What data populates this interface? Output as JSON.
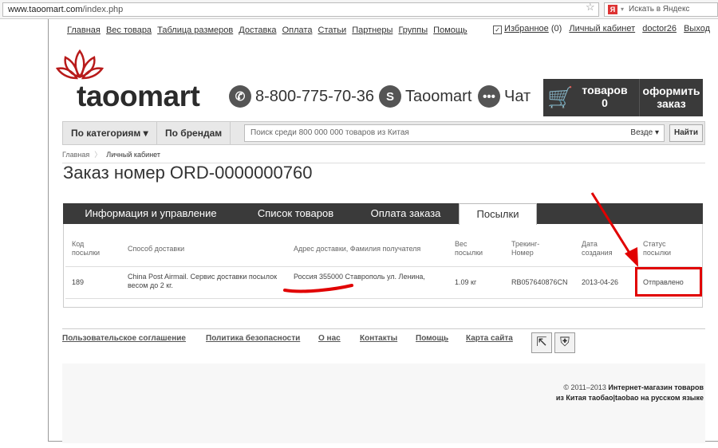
{
  "browser": {
    "url_host": "www.taoomart.com",
    "url_path": "/index.php",
    "search_placeholder": "Искать в Яндекс",
    "yandex_letter": "Я"
  },
  "topnav": [
    "Главная",
    "Вес товара",
    "Таблица размеров",
    "Доставка",
    "Оплата",
    "Статьи",
    "Партнеры",
    "Группы",
    "Помощь"
  ],
  "usernav": {
    "favorites": "Избранное",
    "favorites_count": "(0)",
    "account": "Личный кабинет",
    "username": "doctor26",
    "logout": "Выход"
  },
  "logo_text": "taoomart",
  "contacts": {
    "phone": "8-800-775-70-36",
    "skype": "Taoomart",
    "chat": "Чат"
  },
  "cart": {
    "label": "товаров",
    "count": "0"
  },
  "checkout": {
    "line1": "оформить",
    "line2": "заказ"
  },
  "catbar": {
    "categories": "По категориям ▾",
    "brands": "По брендам",
    "search_placeholder": "Поиск среди 800 000 000 товаров из Китая",
    "scope": "Везде ▾",
    "find": "Найти"
  },
  "breadcrumbs": [
    "Главная",
    "Личный кабинет"
  ],
  "page_title": "Заказ номер ORD-0000000760",
  "tabs": [
    "Информация и управление",
    "Список товаров",
    "Оплата заказа",
    "Посылки"
  ],
  "table": {
    "headers": [
      "Код\nпосылки",
      "Способ доставки",
      "Адрес доставки, Фамилия получателя",
      "Вес\nпосылки",
      "Трекинг-\nНомер",
      "Дата\nсоздания",
      "Статус\nпосылки"
    ],
    "rows": [
      [
        "189",
        "China Post Airmail. Сервис доставки посылок весом до 2 кг.",
        "Россия 355000 Ставрополь ул. Ленина,",
        "1.09 кг",
        "RB057640876CN",
        "2013-04-26",
        "Отправлено"
      ]
    ]
  },
  "footer_links": [
    "Пользовательское соглашение",
    "Политика безопасности",
    "О нас",
    "Контакты",
    "Помощь",
    "Карта сайта"
  ],
  "copyright": {
    "prefix": "© 2011–2013",
    "line1": "Интернет-магазин товаров",
    "line2": "из Китая таобао|taobao на русском языке"
  },
  "colors": {
    "accent_red": "#e10000",
    "dark_bar": "#3a3a3a"
  }
}
